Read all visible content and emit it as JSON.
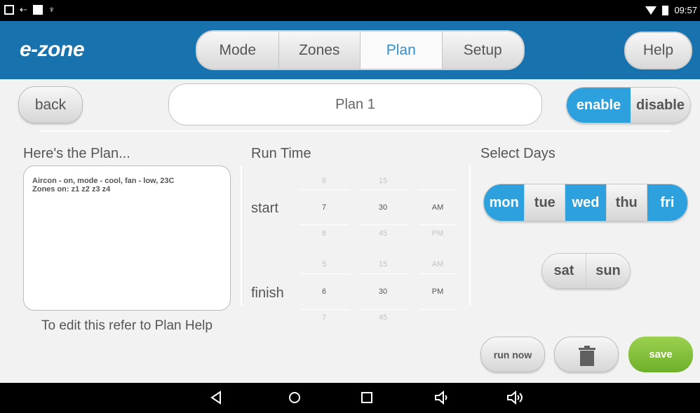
{
  "statusbar": {
    "time": "09:57"
  },
  "header": {
    "logo": "e-zone",
    "tabs": [
      {
        "label": "Mode"
      },
      {
        "label": "Zones"
      },
      {
        "label": "Plan"
      },
      {
        "label": "Setup"
      }
    ],
    "help_label": "Help"
  },
  "toolbar": {
    "back_label": "back",
    "plan_name": "Plan 1",
    "enable_label": "enable",
    "disable_label": "disable"
  },
  "plan": {
    "title": "Here's the Plan...",
    "lines": [
      "Aircon - on, mode - cool, fan - low, 23C",
      "Zones on: z1  z2  z3  z4"
    ],
    "edit_note": "To edit this refer to Plan Help"
  },
  "run_time": {
    "title": "Run Time",
    "start_label": "start",
    "finish_label": "finish",
    "start": {
      "hour": {
        "prev": "6",
        "current": "7",
        "next": "8"
      },
      "minute": {
        "prev": "15",
        "current": "30",
        "next": "45"
      },
      "ampm": {
        "prev": "",
        "current": "AM",
        "next": "PM"
      }
    },
    "finish": {
      "hour": {
        "prev": "5",
        "current": "6",
        "next": "7"
      },
      "minute": {
        "prev": "15",
        "current": "30",
        "next": "45"
      },
      "ampm": {
        "prev": "AM",
        "current": "PM",
        "next": ""
      }
    }
  },
  "days": {
    "title": "Select Days",
    "weekdays": [
      {
        "label": "mon",
        "selected": true
      },
      {
        "label": "tue",
        "selected": false
      },
      {
        "label": "wed",
        "selected": true
      },
      {
        "label": "thu",
        "selected": false
      },
      {
        "label": "fri",
        "selected": true
      }
    ],
    "weekend": [
      {
        "label": "sat",
        "selected": false
      },
      {
        "label": "sun",
        "selected": false
      }
    ]
  },
  "actions": {
    "run_now_label": "run now",
    "delete_icon": "trash-icon",
    "save_label": "save"
  },
  "colors": {
    "header": "#1772ad",
    "accent": "#2da1dd",
    "save": "#7dbd35"
  }
}
